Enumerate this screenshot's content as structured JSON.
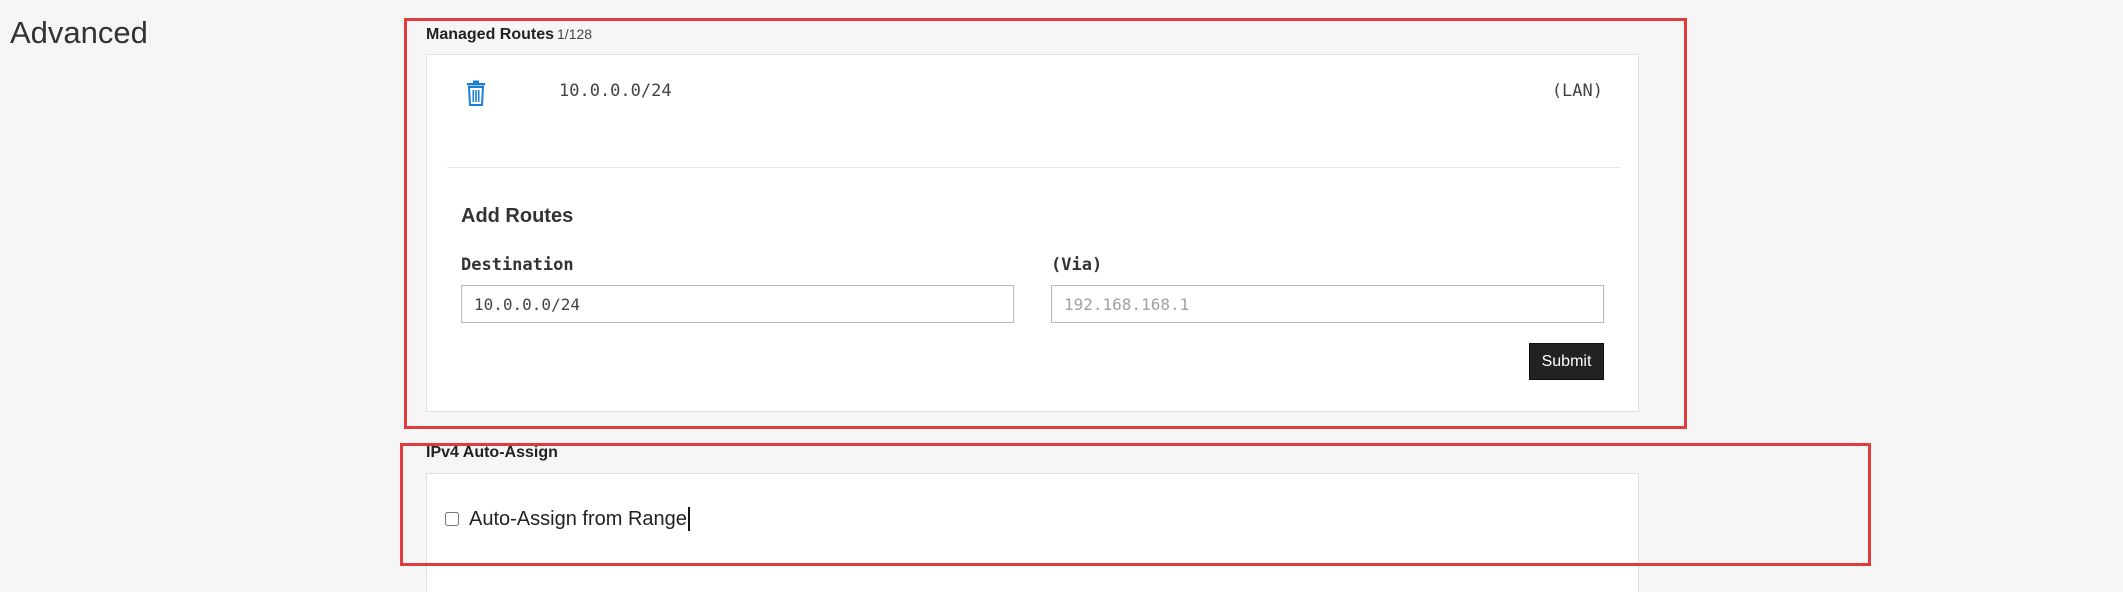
{
  "page": {
    "title": "Advanced"
  },
  "managed_routes": {
    "label": "Managed Routes",
    "count": "1/128",
    "routes": [
      {
        "destination": "10.0.0.0/24",
        "via": "(LAN)"
      }
    ],
    "add": {
      "title": "Add Routes",
      "destination_label": "Destination",
      "destination_value": "10.0.0.0/24",
      "via_label": "(Via)",
      "via_placeholder": "192.168.168.1",
      "submit_label": "Submit"
    }
  },
  "ipv4_auto_assign": {
    "label": "IPv4 Auto-Assign",
    "checkbox_label": "Auto-Assign from Range",
    "checked": false
  },
  "colors": {
    "highlight": "#e23b3b",
    "trash_icon": "#1a7fd6",
    "button_bg": "#222222"
  }
}
